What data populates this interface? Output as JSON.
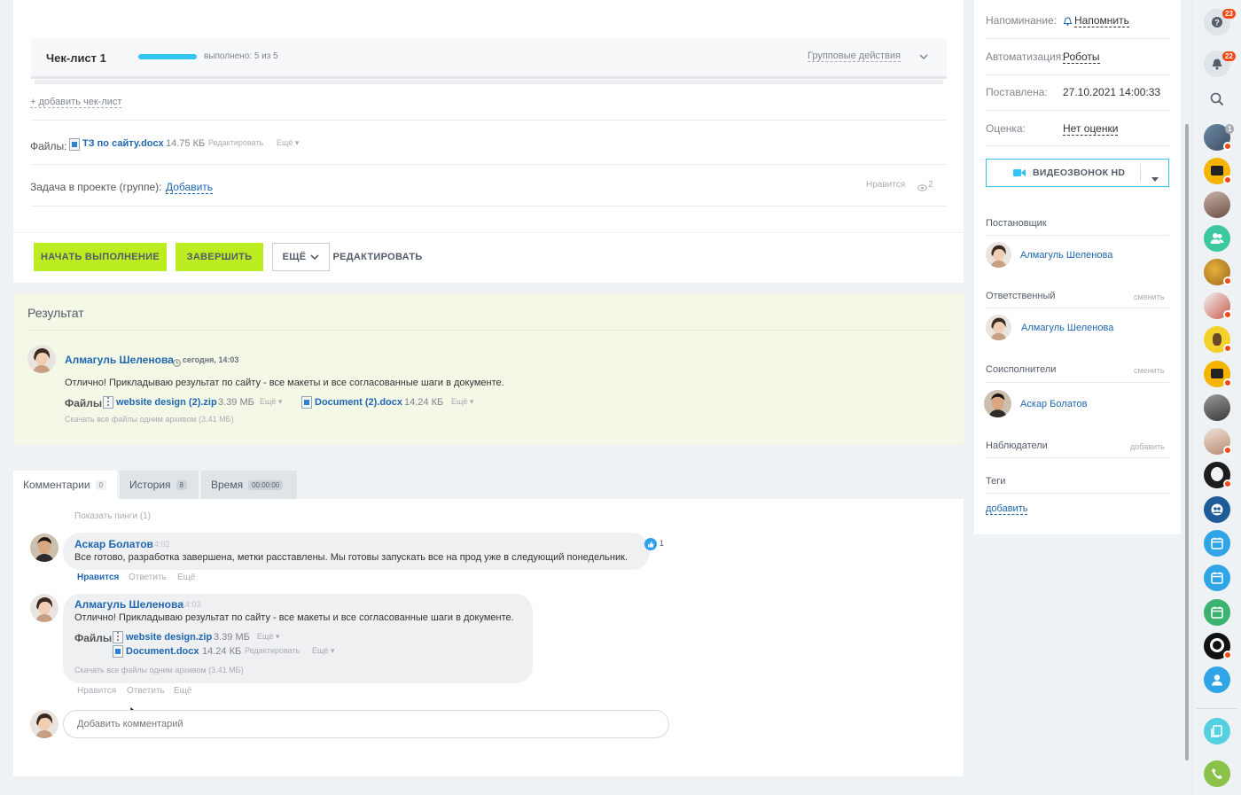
{
  "checklist": {
    "title": "Чек-лист 1",
    "progress": 1.0,
    "progress_text": "выполнено: 5 из 5",
    "group_actions": "Групповые действия",
    "add_checklist": "+ добавить чек-лист"
  },
  "files": {
    "label": "Файлы:",
    "name": "ТЗ по сайту.docx",
    "size": "14.75 КБ",
    "edit": "Редактировать",
    "more": "Ещё"
  },
  "project": {
    "label": "Задача в проекте (группе):",
    "add": "Добавить",
    "like": "Нравится",
    "views": "2"
  },
  "actions": {
    "start": "НАЧАТЬ ВЫПОЛНЕНИЕ",
    "finish": "ЗАВЕРШИТЬ",
    "more": "ЕЩЁ",
    "edit": "РЕДАКТИРОВАТЬ"
  },
  "result": {
    "title": "Результат",
    "author": "Алмагуль Шеленова",
    "time": "сегодня, 14:03",
    "text": "Отлично! Прикладываю результат по сайту - все макеты и все согласованные шаги в документе.",
    "files_label": "Файлы:",
    "file1": "website design (2).zip",
    "file1_size": "3.39 МБ",
    "file2": "Document (2).docx",
    "file2_size": "14.24 КБ",
    "more": "Ещё",
    "download_all": "Скачать все файлы одним архивом (3.41 МБ)"
  },
  "tabs": [
    {
      "label": "Комментарии",
      "count": "0"
    },
    {
      "label": "История",
      "count": "8"
    },
    {
      "label": "Время",
      "count": "00:00:00"
    }
  ],
  "comments": {
    "show_pings": "Показать пинги (1)",
    "c1": {
      "author": "Аскар Болатов",
      "time": "4:02",
      "text": "Все готово, разработка завершена, метки расставлены. Мы готовы запускать все на прод уже в следующий понедельник.",
      "like": "Нравится",
      "reply": "Ответить",
      "more": "Ещё",
      "likes": "1"
    },
    "c2": {
      "author": "Алмагуль Шеленова",
      "time": "14:03",
      "text": "Отлично! Прикладываю результат по сайту - все макеты и все согласованные шаги в документе.",
      "files_label": "Файлы:",
      "file1": "website design.zip",
      "file1_size": "3.39 МБ",
      "file2": "Document.docx",
      "file2_size": "14.24 КБ",
      "edit": "Редактировать",
      "more": "Ещё",
      "download_all": "Скачать все файлы одним архивом (3.41 МБ)",
      "like": "Нравится",
      "reply": "Ответить",
      "more2": "Ещё"
    },
    "placeholder": "Добавить комментарий"
  },
  "sidebar": {
    "reminder_label": "Напоминание:",
    "reminder_value": "Напомнить",
    "automation_label": "Автоматизация:",
    "automation_value": "Роботы",
    "set_label": "Поставлена:",
    "set_value": "27.10.2021 14:00:33",
    "rating_label": "Оценка:",
    "rating_value": "Нет оценки",
    "video_call": "ВИДЕОЗВОНОК HD",
    "creator_title": "Постановщик",
    "creator": "Алмагуль Шеленова",
    "responsible_title": "Ответственный",
    "responsible": "Алмагуль Шеленова",
    "change": "сменить",
    "coexec_title": "Соисполнители",
    "coexec": "Аскар Болатов",
    "change2": "сменить",
    "observers_title": "Наблюдатели",
    "observers_add": "добавить",
    "tags_title": "Теги",
    "tags_add": "добавить"
  },
  "rightbar": {
    "help_badge": "23",
    "notif_badge": "22",
    "avatar_badge": "1"
  },
  "colors": {
    "accent_green": "#bbed21",
    "link": "#2067b0",
    "progress": "#2fc6f6",
    "result_bg": "#f4f8e6"
  }
}
